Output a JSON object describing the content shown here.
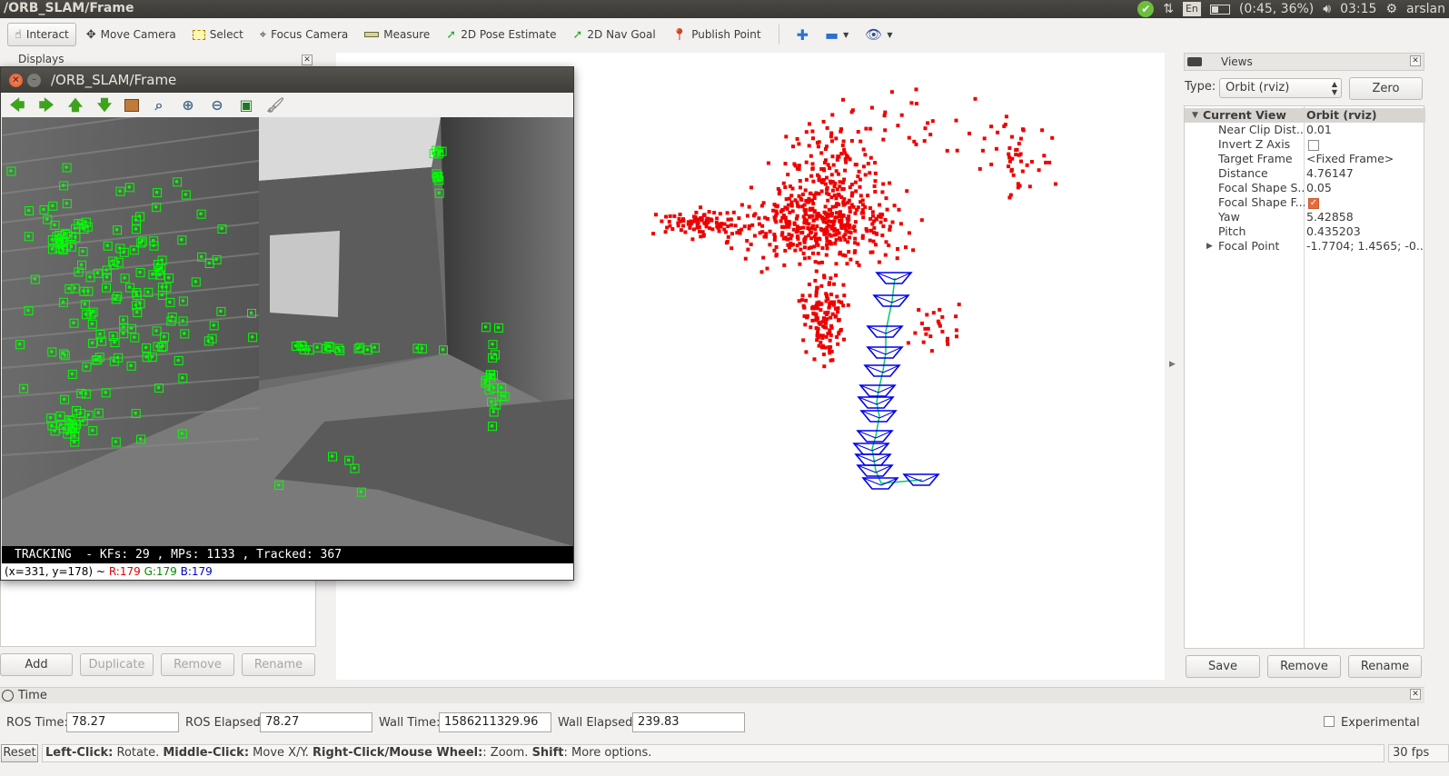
{
  "window": {
    "title": "/ORB_SLAM/Frame"
  },
  "tray": {
    "lang": "En",
    "battery": "(0:45, 36%)",
    "clock": "03:15",
    "user": "arslan"
  },
  "toolbar": {
    "tools": [
      {
        "label": "Interact",
        "icon": "cursor-icon"
      },
      {
        "label": "Move Camera",
        "icon": "move-icon"
      },
      {
        "label": "Select",
        "icon": "select-icon"
      },
      {
        "label": "Focus Camera",
        "icon": "focus-icon"
      },
      {
        "label": "Measure",
        "icon": "ruler-icon"
      },
      {
        "label": "2D Pose Estimate",
        "icon": "arrow-green-icon"
      },
      {
        "label": "2D Nav Goal",
        "icon": "arrow-green-icon"
      },
      {
        "label": "Publish Point",
        "icon": "pin-icon"
      }
    ]
  },
  "displays": {
    "title": "Displays",
    "add": "Add",
    "duplicate": "Duplicate",
    "remove": "Remove",
    "rename": "Rename"
  },
  "frame_window": {
    "title": "/ORB_SLAM/Frame",
    "status_line": "TRACKING  - KFs: 29 , MPs: 1133 , Tracked: 367",
    "pixel_info": {
      "pos": "(x=331, y=178) ~",
      "r": "R:179",
      "g": "G:179",
      "b": "B:179"
    }
  },
  "views": {
    "title": "Views",
    "type_label": "Type:",
    "type_value": "Orbit (rviz)",
    "zero": "Zero",
    "current_view": {
      "key": "Current View",
      "value": "Orbit (rviz)"
    },
    "properties": [
      {
        "key": "Near Clip Dist...",
        "value": "0.01"
      },
      {
        "key": "Invert Z Axis",
        "value": ""
      },
      {
        "key": "Target Frame",
        "value": "<Fixed Frame>"
      },
      {
        "key": "Distance",
        "value": "4.76147"
      },
      {
        "key": "Focal Shape S...",
        "value": "0.05"
      },
      {
        "key": "Focal Shape F...",
        "value": ""
      },
      {
        "key": "Yaw",
        "value": "5.42858"
      },
      {
        "key": "Pitch",
        "value": "0.435203"
      },
      {
        "key": "Focal Point",
        "value": "-1.7704; 1.4565; -0...."
      }
    ],
    "save": "Save",
    "remove": "Remove",
    "rename": "Rename"
  },
  "time": {
    "title": "Time",
    "ros_time_label": "ROS Time:",
    "ros_time": "78.27",
    "ros_elapsed_label": "ROS Elapsed:",
    "ros_elapsed": "78.27",
    "wall_time_label": "Wall Time:",
    "wall_time": "1586211329.96",
    "wall_elapsed_label": "Wall Elapsed:",
    "wall_elapsed": "239.83",
    "experimental": "Experimental"
  },
  "status": {
    "reset": "Reset",
    "h1": "Left-Click:",
    "t1": " Rotate. ",
    "h2": "Middle-Click:",
    "t2": " Move X/Y. ",
    "h3": "Right-Click/Mouse Wheel:",
    "t3": ": Zoom. ",
    "h4": "Shift",
    "t4": ": More options.",
    "fps": "30 fps"
  },
  "colors": {
    "map_points": "#ee0000",
    "keyframes": "#0000ee",
    "features": "#00ff00",
    "graph": "#00cc66"
  }
}
